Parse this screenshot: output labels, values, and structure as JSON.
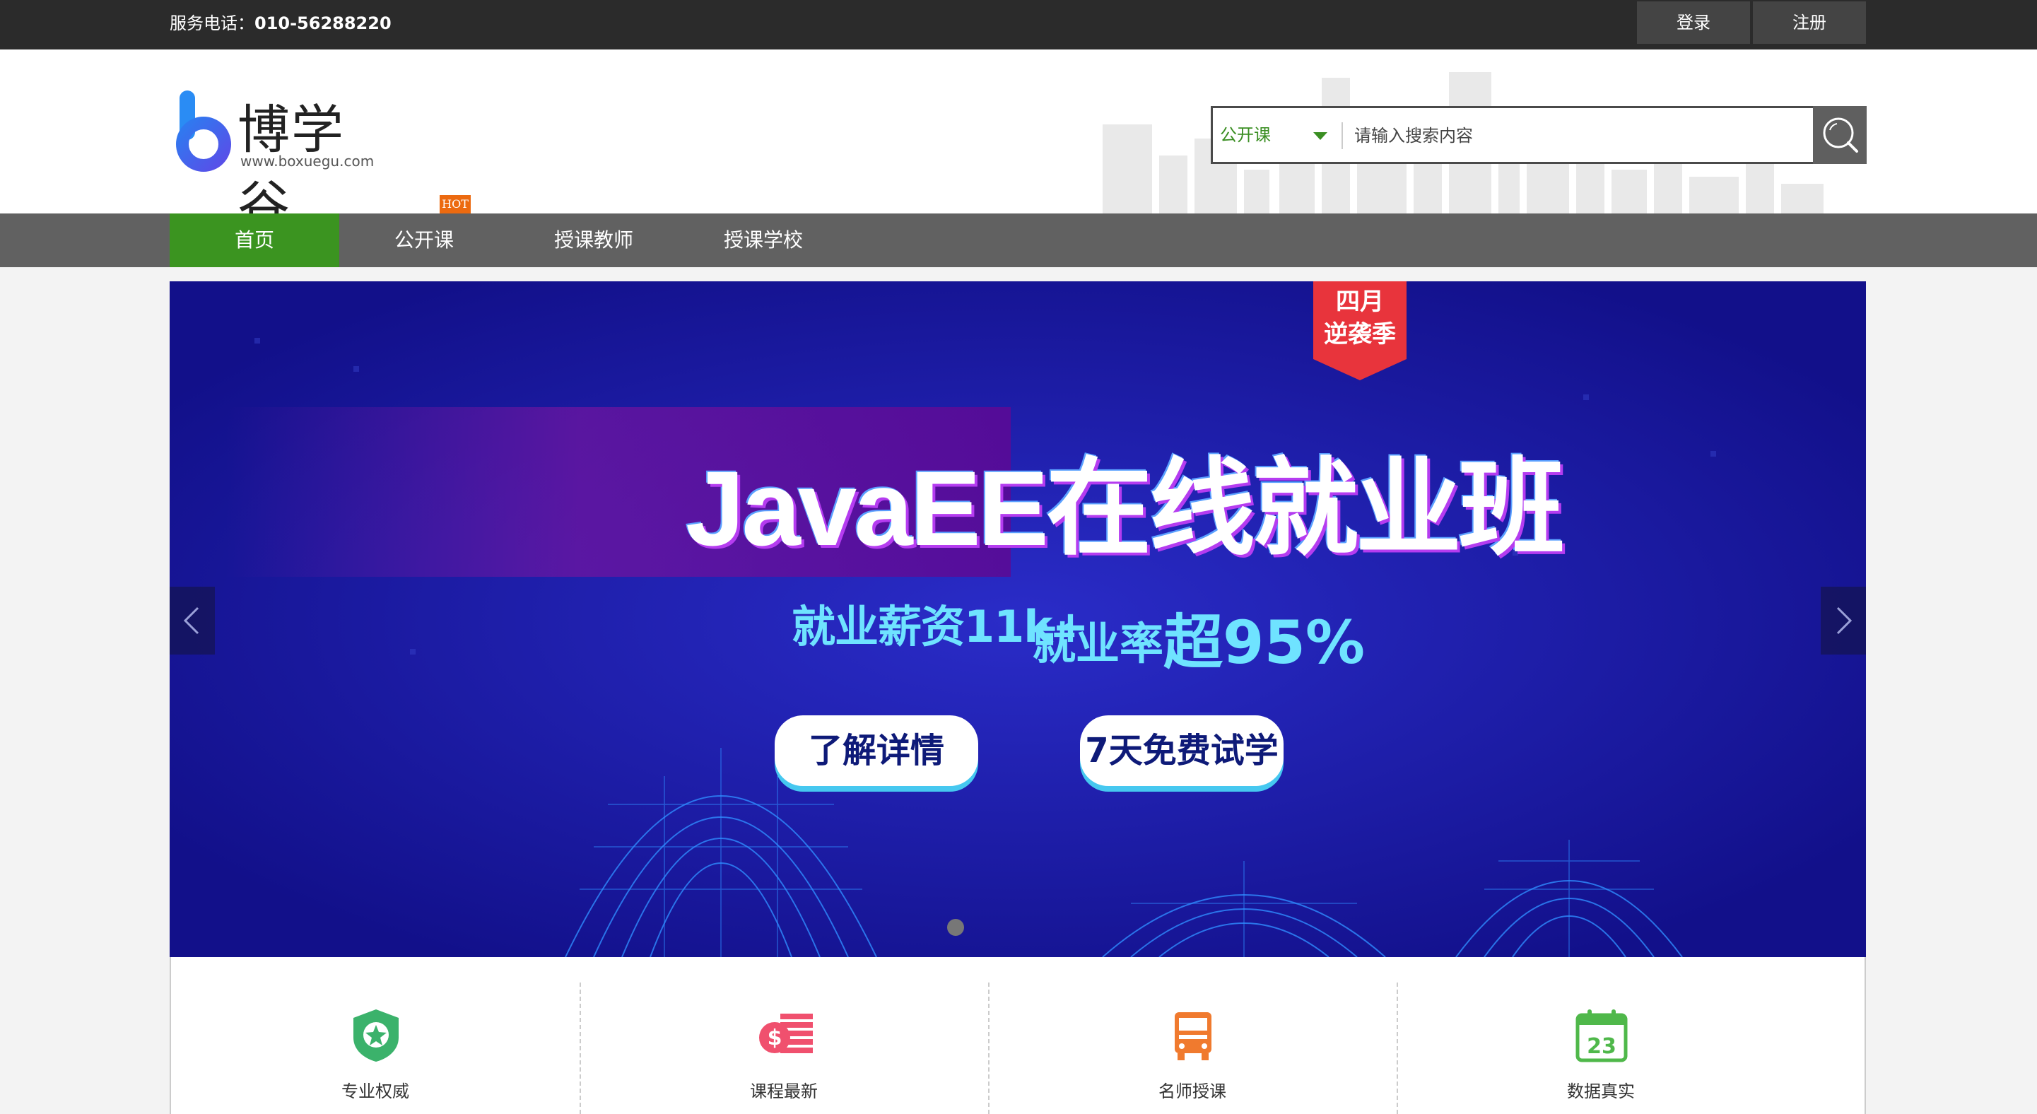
{
  "topbar": {
    "hotline_label": "服务电话：",
    "hotline_number": "010-56288220",
    "login_label": "登录",
    "register_label": "注册"
  },
  "header": {
    "logo_text": "博学谷",
    "logo_url": "www.boxuegu.com",
    "search": {
      "category": "公开课",
      "placeholder": "请输入搜索内容",
      "value": ""
    }
  },
  "nav": {
    "items": [
      {
        "label": "首页",
        "active": true
      },
      {
        "label": "公开课",
        "active": false
      },
      {
        "label": "授课教师",
        "active": false
      },
      {
        "label": "授课学校",
        "active": false
      }
    ],
    "hot_badge": "HOT"
  },
  "banner": {
    "ribbon_line1": "四月",
    "ribbon_line2": "逆袭季",
    "headline": "JavaEE在线就业班",
    "sub_left": "就业薪资11k+",
    "sub_right_prefix": "就业率",
    "sub_right_em": "超95%",
    "cta_detail": "了解详情",
    "cta_trial": "7天免费试学",
    "accent_color": "#46c8f0",
    "background_color": "#16149a"
  },
  "features": [
    {
      "label": "专业权威",
      "icon": "badge-star-icon",
      "color": "#3bb26b"
    },
    {
      "label": "课程最新",
      "icon": "money-list-icon",
      "color": "#f0506e"
    },
    {
      "label": "名师授课",
      "icon": "bus-icon",
      "color": "#f07a2e"
    },
    {
      "label": "数据真实",
      "icon": "calendar-23-icon",
      "color": "#4fb84a",
      "number": "23"
    }
  ]
}
